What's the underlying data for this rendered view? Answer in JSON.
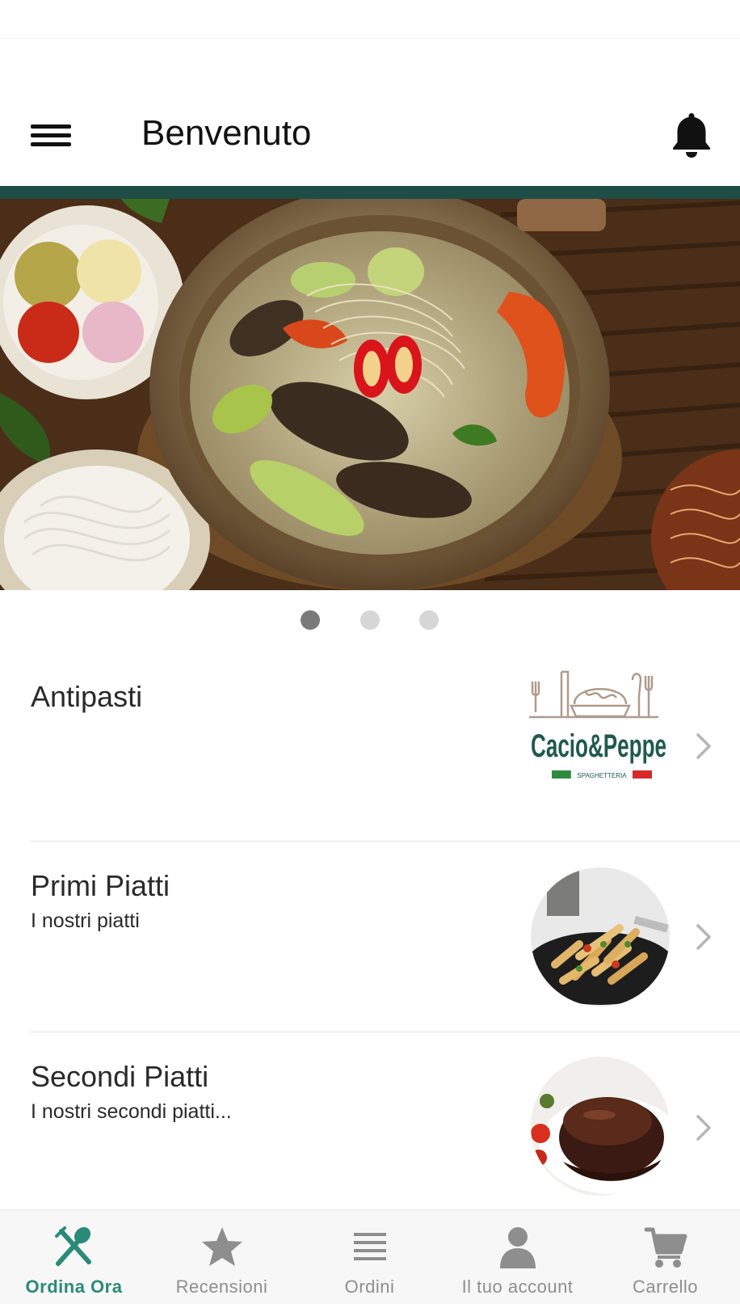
{
  "header": {
    "title": "Benvenuto"
  },
  "carousel": {
    "slide_count": 3,
    "active_index": 0
  },
  "categories": [
    {
      "title": "Antipasti",
      "subtitle": "",
      "thumb": "cacio-e-pepe-logo",
      "logo_text": "Cacio&Peppe",
      "logo_tagline": "SPAGHETTERIA"
    },
    {
      "title": "Primi Piatti",
      "subtitle": "I nostri piatti",
      "thumb": "pasta-photo"
    },
    {
      "title": "Secondi Piatti",
      "subtitle": "I nostri secondi piatti...",
      "thumb": "steak-photo"
    }
  ],
  "tabbar": {
    "items": [
      {
        "label": "Ordina Ora",
        "icon": "fork-spoon-icon",
        "active": true
      },
      {
        "label": "Recensioni",
        "icon": "star-icon",
        "active": false
      },
      {
        "label": "Ordini",
        "icon": "list-icon",
        "active": false
      },
      {
        "label": "Il tuo account",
        "icon": "user-icon",
        "active": false
      },
      {
        "label": "Carrello",
        "icon": "cart-icon",
        "active": false
      }
    ]
  },
  "colors": {
    "accent_bar": "#1e4d46",
    "active_tab": "#2a8a78",
    "inactive_tab": "#8e8e8e",
    "logo_green": "#1f5a4e"
  }
}
